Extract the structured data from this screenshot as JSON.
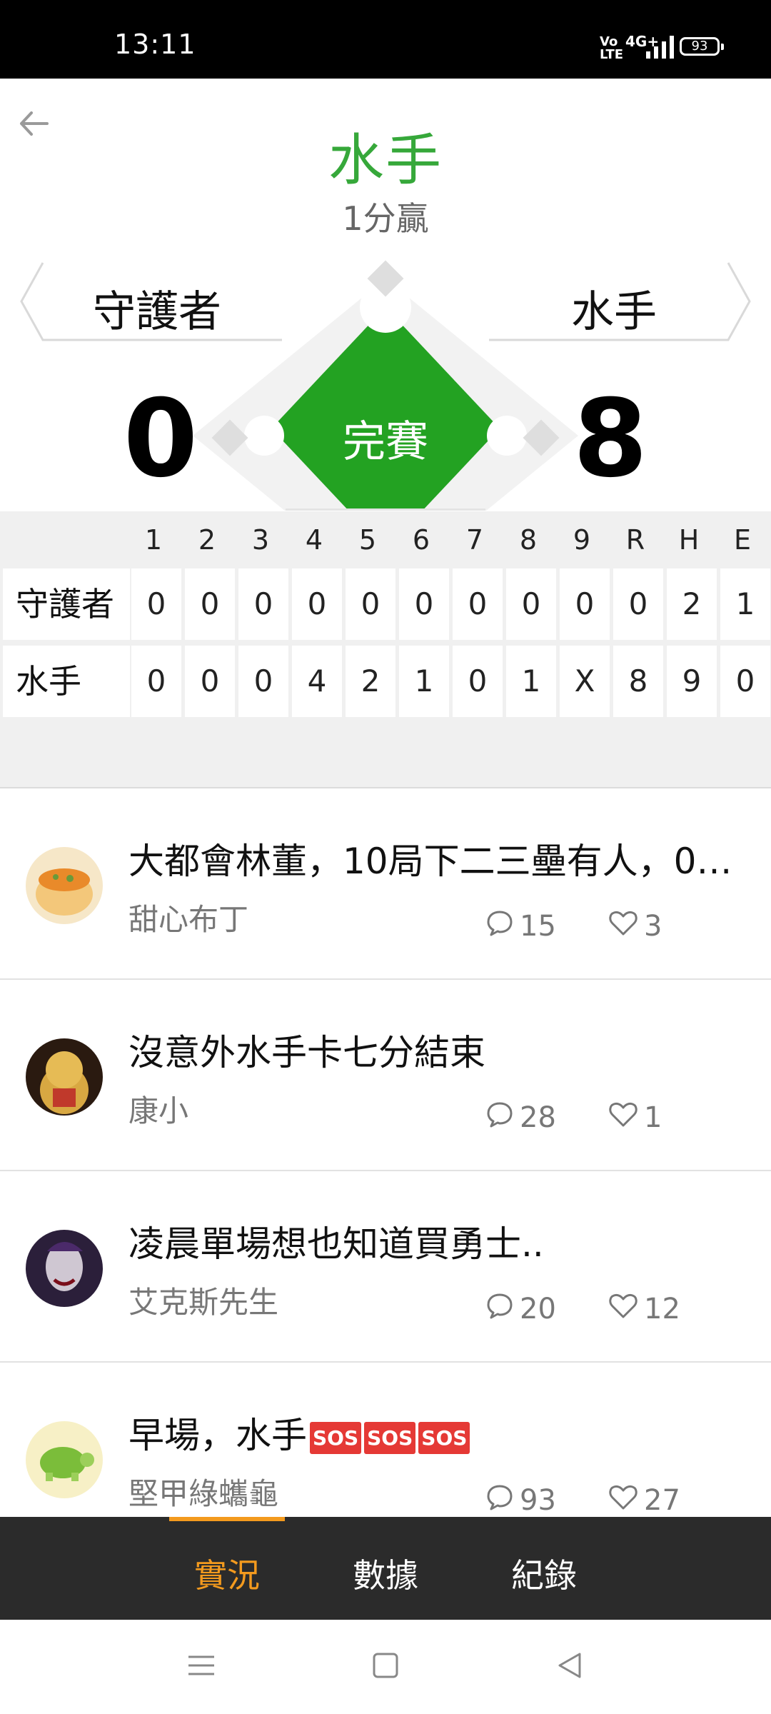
{
  "status_bar": {
    "time": "13:11",
    "volte": "Vo\nLTE",
    "network": "4G+",
    "battery": "93"
  },
  "header": {
    "title": "水手",
    "subtitle": "1分贏"
  },
  "game": {
    "away_team": "守護者",
    "home_team": "水手",
    "away_score": "0",
    "home_score": "8",
    "state": "完賽"
  },
  "linescore": {
    "columns": [
      "1",
      "2",
      "3",
      "4",
      "5",
      "6",
      "7",
      "8",
      "9",
      "R",
      "H",
      "E"
    ],
    "rows": [
      {
        "team": "守護者",
        "values": [
          "0",
          "0",
          "0",
          "0",
          "0",
          "0",
          "0",
          "0",
          "0",
          "0",
          "2",
          "1"
        ]
      },
      {
        "team": "水手",
        "values": [
          "0",
          "0",
          "0",
          "4",
          "2",
          "1",
          "0",
          "1",
          "X",
          "8",
          "9",
          "0"
        ]
      }
    ]
  },
  "posts": [
    {
      "title": "大都會林董，10局下二三壘有人，0人...",
      "author": "甜心布丁",
      "comments": "15",
      "likes": "3",
      "avatar": "pudding-avatar"
    },
    {
      "title": "沒意外水手卡七分結束",
      "author": "康小",
      "comments": "28",
      "likes": "1",
      "avatar": "lucky-cat-avatar"
    },
    {
      "title": "凌晨單場想也知道買勇士..",
      "author": "艾克斯先生",
      "comments": "20",
      "likes": "12",
      "avatar": "joker-avatar"
    },
    {
      "title": "早場，水手",
      "sos": [
        "SOS",
        "SOS",
        "SOS"
      ],
      "author": "堅甲綠蠵龜",
      "comments": "93",
      "likes": "27",
      "avatar": "turtle-avatar"
    }
  ],
  "tabs": [
    {
      "label": "實況",
      "active": true
    },
    {
      "label": "數據",
      "active": false
    },
    {
      "label": "紀錄",
      "active": false
    }
  ],
  "colors": {
    "brand_green": "#36a83a",
    "field_green": "#23a222",
    "accent_orange": "#f39a1e",
    "tabbar": "#2b2b2b"
  }
}
